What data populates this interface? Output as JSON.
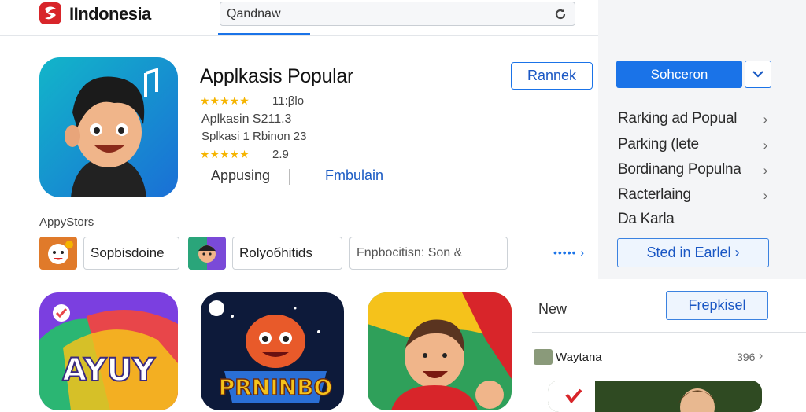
{
  "header": {
    "brand": "IIndonesia",
    "search_value": "Qandnaw",
    "icons": [
      "search-icon",
      "bookmark-icon",
      "notification-icon",
      "profile-icon"
    ]
  },
  "app": {
    "title": "Applkasiѕ Popular",
    "rating_1": "11:βlo",
    "line_1": "Aplkasin S211.3",
    "line_2": "Splkasi 1 Rbinon 23",
    "rating_2": "2.9",
    "install_label": "Rannek",
    "tab_1": "Appusing",
    "tab_2": "Fmbulain"
  },
  "section_label": "AppyStors",
  "chips": [
    {
      "label": "Sopbisdoine"
    },
    {
      "label": "Rolyoбhitids"
    },
    {
      "label": "Fnpbocitisn: Son &"
    }
  ],
  "more_link": "••••• ›",
  "thumbs": [
    {
      "text": "AYUY"
    },
    {
      "text": "PRNINBO"
    },
    {
      "text": ""
    }
  ],
  "right_panel": {
    "primary_label": "Sohcеron",
    "menu": [
      {
        "label": "Rarking ad Popual"
      },
      {
        "label": "Parking (lete"
      },
      {
        "label": "Bordinang Populna"
      },
      {
        "label": "Racterlaing"
      },
      {
        "label": "Da Karla"
      }
    ],
    "outline_label": "Sted in Earlel ›",
    "new_label": "New",
    "secondary_label": "Frepkisel",
    "row_title": "Waytana",
    "row_count": "396"
  },
  "colors": {
    "accent": "#1a73e8",
    "brand_red": "#d8252a",
    "star": "#f5b400"
  }
}
